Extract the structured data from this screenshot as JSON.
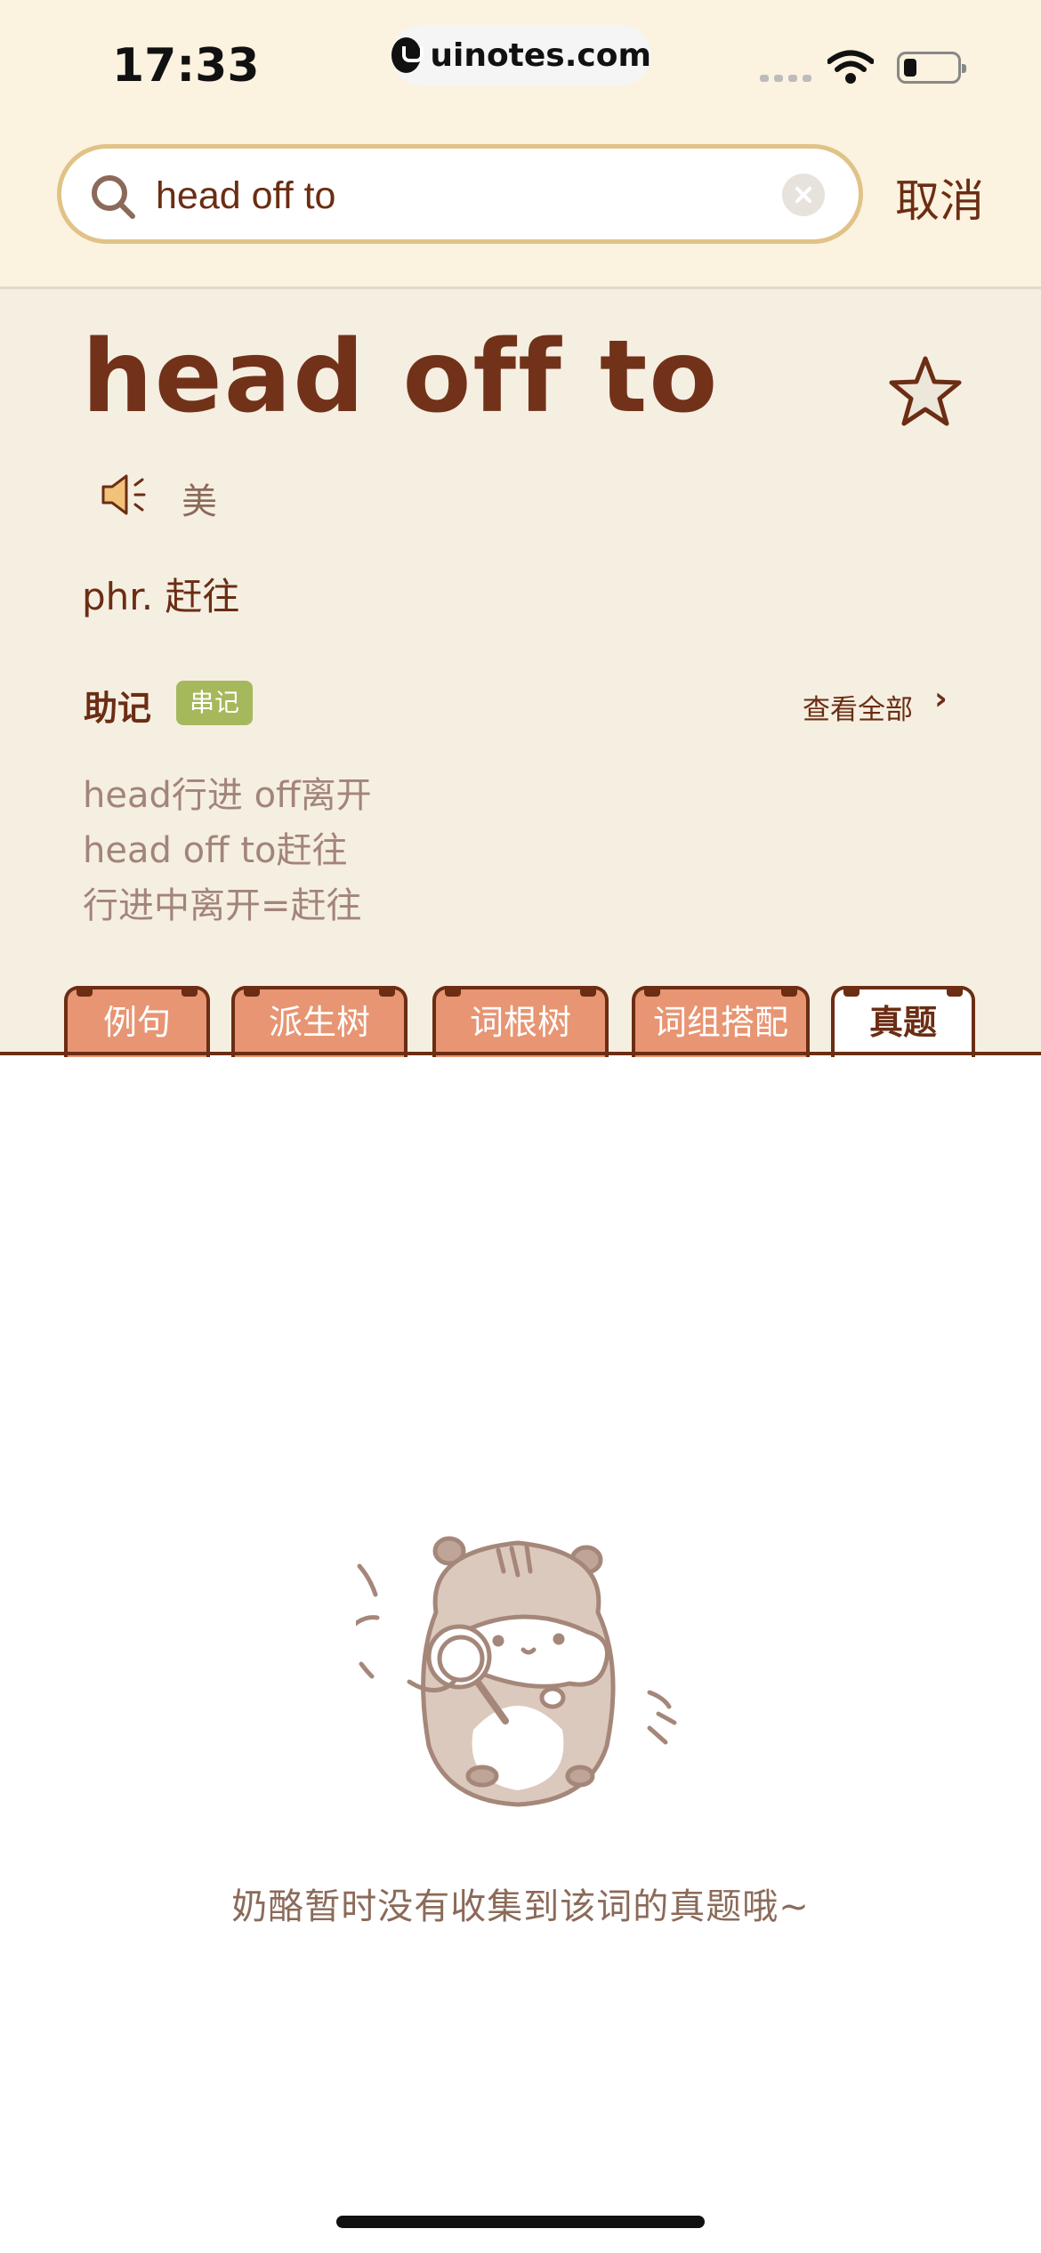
{
  "status_bar": {
    "time": "17:33",
    "url": "uinotes.com"
  },
  "search": {
    "value": "head off to",
    "cancel_label": "取消"
  },
  "word": {
    "headword": "head off to",
    "accent": "美",
    "definition": "phr. 赶往"
  },
  "mnemonic": {
    "title": "助记",
    "badge": "串记",
    "view_all": "查看全部",
    "lines": [
      "head行进 off离开",
      "head off to赶往",
      "行进中离开=赶往"
    ]
  },
  "tabs": [
    {
      "label": "例句",
      "active": false
    },
    {
      "label": "派生树",
      "active": false
    },
    {
      "label": "词根树",
      "active": false
    },
    {
      "label": "词组搭配",
      "active": false
    },
    {
      "label": "真题",
      "active": true
    }
  ],
  "empty_state": {
    "message": "奶酪暂时没有收集到该词的真题哦~"
  },
  "colors": {
    "brand_brown": "#6b2d13",
    "tab_orange": "#e79573",
    "badge_green": "#a6b85c",
    "cream": "#fbf2df"
  }
}
